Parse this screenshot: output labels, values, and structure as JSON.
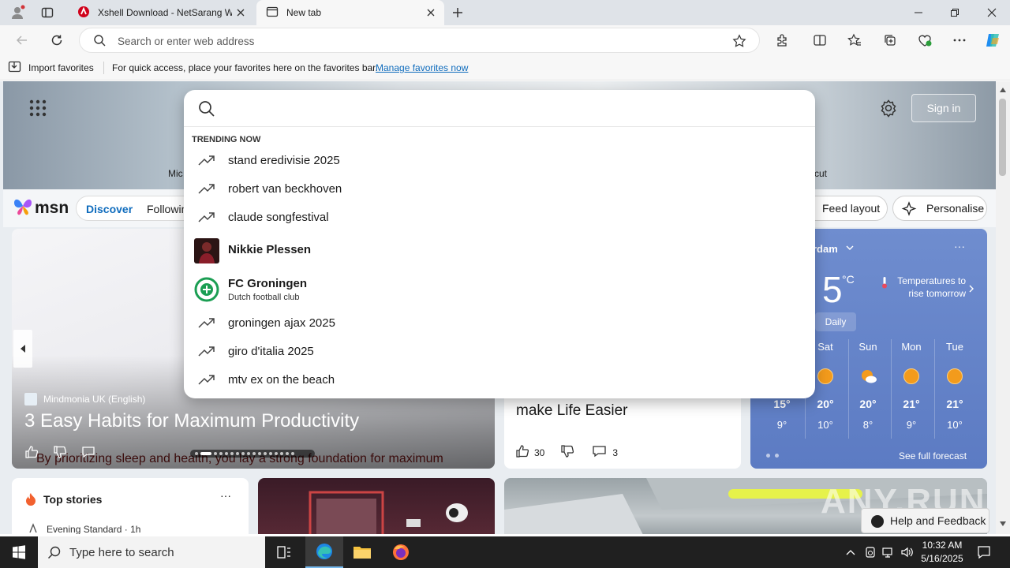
{
  "browser": {
    "tabs": [
      {
        "title": "Xshell Download - NetSarang Website"
      },
      {
        "title": "New tab"
      }
    ],
    "address_placeholder": "Search or enter web address",
    "favorites_bar": {
      "import_label": "Import favorites",
      "hint": "For quick access, place your favorites here on the favorites bar.",
      "manage_link": "Manage favorites now"
    }
  },
  "page": {
    "sign_in": "Sign in",
    "hero_fragment_left": "Mic",
    "hero_fragment_right": "cut",
    "msn_logo_text": "msn",
    "feed_tabs": [
      "Discover",
      "Followin"
    ],
    "feed_layout": "Feed layout",
    "personalise": "Personalise",
    "hero_card": {
      "source": "Mindmonia UK (English)",
      "title": "3 Easy Habits for Maximum Productivity",
      "subtitle": "By prioritizing sleep and health, you lay a strong foundation for maximum"
    },
    "mid_card": {
      "title": "make Life Easier",
      "likes": "30",
      "comments": "3"
    },
    "weather": {
      "location": "rdam",
      "temp": "5",
      "unit": "°C",
      "note": "Temperatures to rise tomorrow",
      "daily_tab": "Daily",
      "days": [
        "Sat",
        "Sun",
        "Mon",
        "Tue"
      ],
      "first_hi": "15°",
      "first_lo": "9°",
      "highs": [
        "20°",
        "20°",
        "21°",
        "21°"
      ],
      "lows": [
        "10°",
        "8°",
        "9°",
        "10°"
      ],
      "see_forecast": "See full forecast"
    },
    "top_stories": {
      "title": "Top stories",
      "more": "···",
      "source": "Evening Standard · 1h"
    },
    "help_feedback": "Help and Feedback",
    "watermark": "ANY.RUN"
  },
  "search_dropdown": {
    "heading": "TRENDING NOW",
    "suggestions": [
      {
        "text": "stand eredivisie 2025"
      },
      {
        "text": "robert van beckhoven"
      },
      {
        "text": "claude songfestival"
      },
      {
        "name": "Nikkie Plessen"
      },
      {
        "name": "FC Groningen",
        "desc": "Dutch football club"
      },
      {
        "text": "groningen ajax 2025"
      },
      {
        "text": "giro d'italia 2025"
      },
      {
        "text": "mtv ex on the beach"
      }
    ]
  },
  "taskbar": {
    "search_placeholder": "Type here to search",
    "time": "10:32 AM",
    "date": "5/16/2025"
  },
  "colors": {
    "accent": "#0f6cbd",
    "taskbar": "#202020",
    "weather_card": "#6483c7"
  }
}
